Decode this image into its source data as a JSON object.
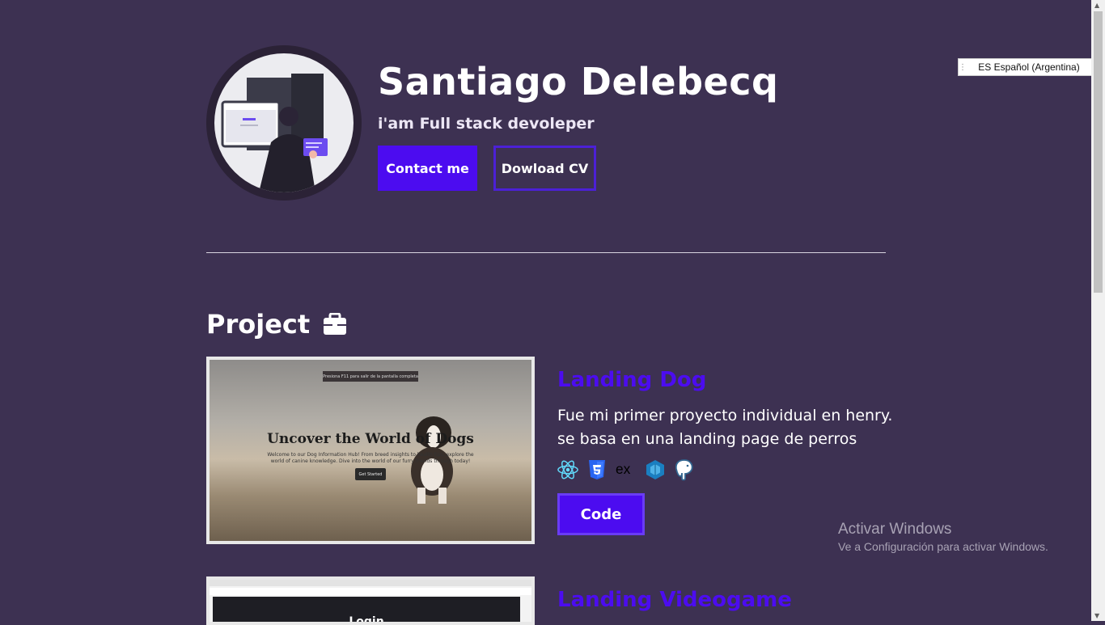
{
  "header": {
    "name": "Santiago Delebecq",
    "role": "i'am Full stack devoleper",
    "contact_label": "Contact me",
    "cv_label": "Dowload CV"
  },
  "projects_section": {
    "title": "Project",
    "icon": "briefcase-icon"
  },
  "projects": [
    {
      "title": "Landing Dog",
      "description": "Fue mi primer proyecto individual en henry. se basa en una landing page de perros",
      "tech_icons": [
        "react-icon",
        "css3-icon",
        "express-icon",
        "sequelize-icon",
        "postgresql-icon"
      ],
      "code_label": "Code",
      "screenshot": {
        "overlay_text": "Presiona F11 para salir de la pantalla completa",
        "hero_title": "Uncover the World of Dogs",
        "hero_text": "Welcome to our Dog Information Hub! From breed insights to health tips, explore the world of canine knowledge. Dive into the world of our furry friends through today!",
        "hero_button": "Get Started"
      }
    },
    {
      "title": "Landing Videogame",
      "screenshot": {
        "login_text": "Login"
      }
    }
  ],
  "language_widget": {
    "label": "ES Español (Argentina)"
  },
  "watermark": {
    "title": "Activar Windows",
    "subtitle": "Ve a Configuración para activar Windows."
  },
  "colors": {
    "background": "#3d3152",
    "accent": "#4c0cf0",
    "text": "#ffffff"
  }
}
